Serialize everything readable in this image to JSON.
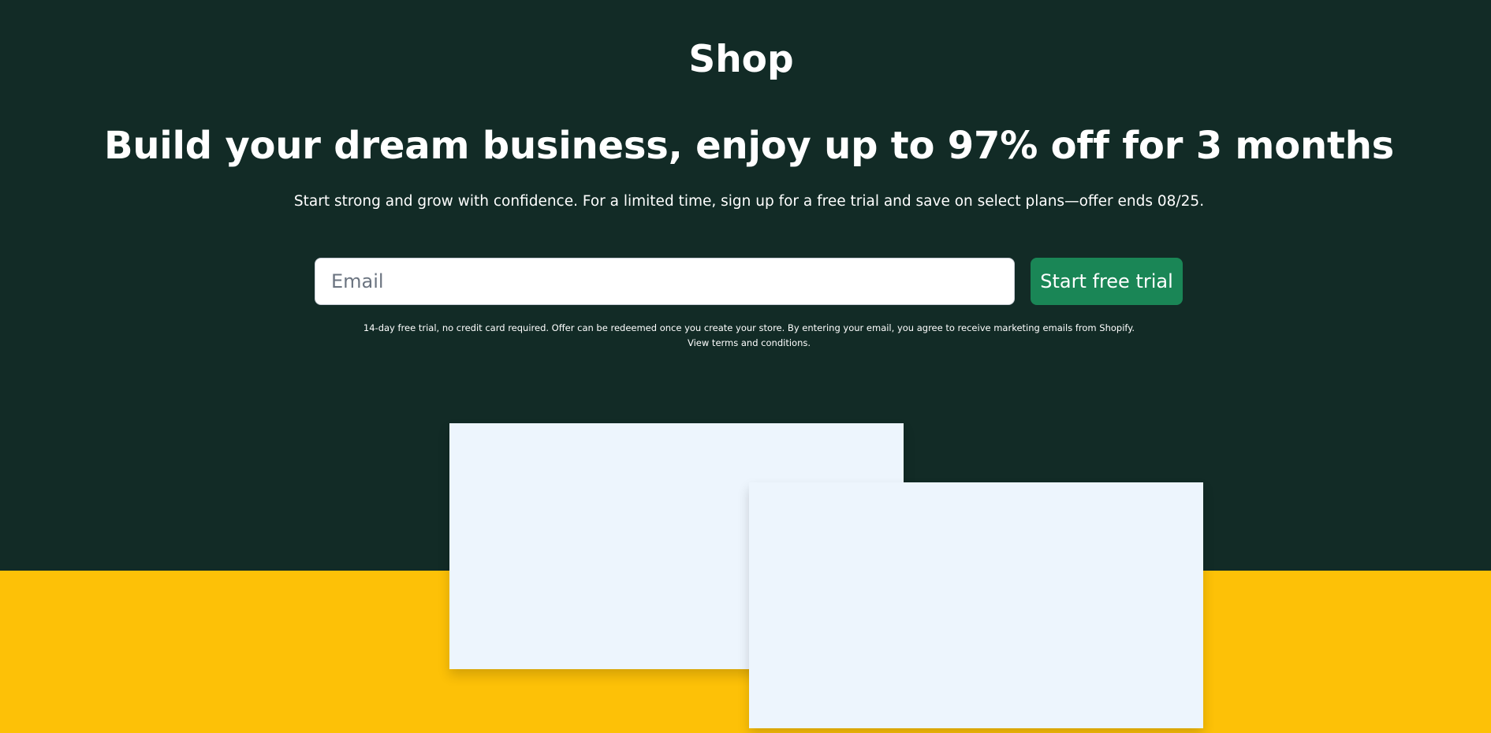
{
  "brand": {
    "logo_text": "Shop"
  },
  "hero": {
    "headline": "Build your dream business, enjoy up to 97% off for 3 months",
    "subheadline": "Start strong and grow with confidence. For a limited time, sign up for a free trial and save on select plans—offer ends 08/25."
  },
  "signup": {
    "email_placeholder": "Email",
    "email_value": "",
    "button_label": "Start free trial"
  },
  "disclaimer": {
    "line1": "14-day free trial, no credit card required. Offer can be redeemed once you create your store. By entering your email, you agree to receive marketing emails from Shopify.",
    "terms_link": "View terms and conditions."
  },
  "colors": {
    "hero_background": "#122b26",
    "band_background": "#fdc107",
    "button_background": "#1a8656",
    "card_background": "#edf5fd",
    "text": "#ffffff"
  }
}
